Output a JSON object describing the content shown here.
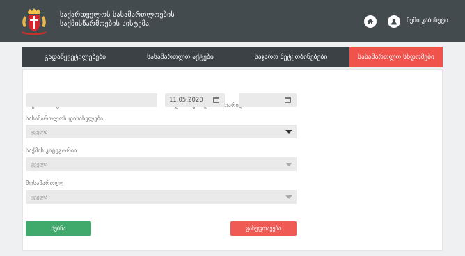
{
  "header": {
    "title_line1": "საქართველოს სასამართლოების",
    "title_line2": "საქმისწარმოების სისტემა",
    "home_icon": "home-icon",
    "user_icon": "user-icon",
    "user_label": "ჩემი კაბინეტი"
  },
  "nav": {
    "items": [
      {
        "label": "გადაწყვეტილებები"
      },
      {
        "label": "სასამართლო აქტები"
      },
      {
        "label": "საჯარო შეტყობინებები"
      },
      {
        "label": "სასამართლო სხდომები"
      }
    ],
    "active_index": 3
  },
  "form": {
    "case_number_label": "საქმის ნომერი",
    "case_number_value": "",
    "date_label": "მიმდინარე სხდომის თარიღი",
    "date_from_value": "11.05.2020",
    "date_to_value": "",
    "court_label": "სასამართლოს დასახელება",
    "court_value": "ყველა",
    "category_label": "საქმის კატეგორია",
    "category_value": "ყველა",
    "judge_label": "მოსამართლე",
    "judge_value": "ყველა",
    "search_button": "ძებნა",
    "clear_button": "გასუფთავება"
  },
  "colors": {
    "header_bg": "#444b4f",
    "nav_bg": "#3b4145",
    "active_tab": "#f0524c",
    "search_btn": "#3faa6c",
    "clear_btn": "#ef5a55"
  }
}
